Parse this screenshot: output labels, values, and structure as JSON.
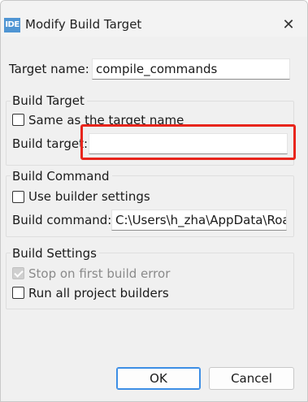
{
  "window": {
    "title": "Modify Build Target",
    "app_icon_text": "IDE",
    "close_glyph": "✕"
  },
  "target_name": {
    "label": "Target name:",
    "value": "compile_commands"
  },
  "build_target_group": {
    "title": "Build Target",
    "same_as_name": {
      "label": "Same as the target name",
      "checked": false
    },
    "build_target": {
      "label": "Build target:",
      "value": ""
    }
  },
  "build_command_group": {
    "title": "Build Command",
    "use_builder_settings": {
      "label": "Use builder settings",
      "checked": false
    },
    "build_command": {
      "label": "Build command:",
      "value": "C:\\Users\\h_zha\\AppData\\Roa"
    }
  },
  "build_settings_group": {
    "title": "Build Settings",
    "stop_on_error": {
      "label": "Stop on first build error",
      "checked": true,
      "enabled": false
    },
    "run_all_builders": {
      "label": "Run all project builders",
      "checked": false
    }
  },
  "buttons": {
    "ok": "OK",
    "cancel": "Cancel"
  },
  "colors": {
    "highlight": "#e8251c",
    "accent": "#3d8ee5",
    "app_icon": "#4f95d3"
  }
}
